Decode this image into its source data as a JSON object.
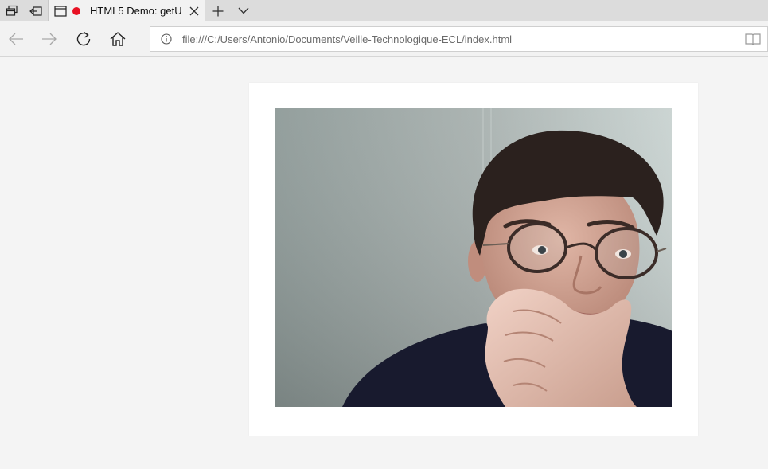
{
  "browser": {
    "tab": {
      "title": "HTML5 Demo: getU",
      "recording": true,
      "recording_color": "#e81123"
    },
    "toolbar_icons": {
      "tab_preview": "tab-preview-icon",
      "set_aside": "set-aside-tabs-icon",
      "page": "page-icon",
      "close": "close-icon",
      "new_tab": "plus-icon",
      "tab_list": "chevron-down-icon",
      "back": "back-arrow-icon",
      "forward": "forward-arrow-icon",
      "refresh": "refresh-icon",
      "home": "home-icon",
      "info": "info-icon",
      "reading_view": "reading-view-icon"
    },
    "address": {
      "url": "file:///C:/Users/Antonio/Documents/Veille-Technologique-ECL/index.html"
    }
  },
  "page": {
    "video": {
      "description_icon": "webcam-video"
    }
  }
}
